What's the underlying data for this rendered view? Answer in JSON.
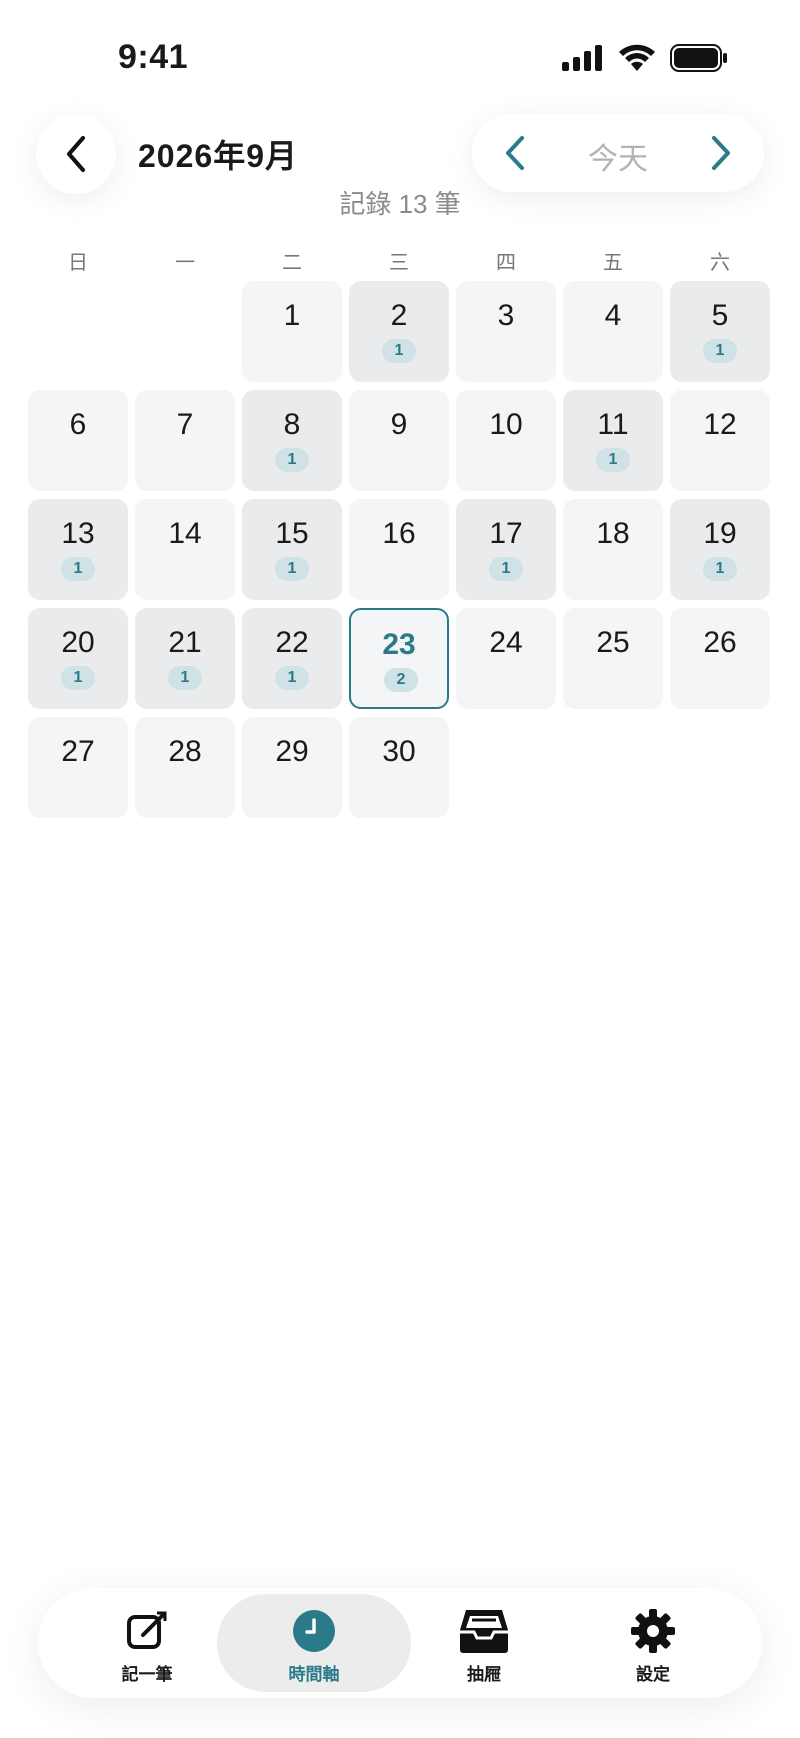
{
  "status_bar": {
    "time": "9:41"
  },
  "header": {
    "title": "2026年9月",
    "today_label": "今天",
    "record_count": "記錄 13 筆"
  },
  "weekdays": [
    "日",
    "一",
    "二",
    "三",
    "四",
    "五",
    "六"
  ],
  "calendar": {
    "first_weekday_index": 2,
    "days_in_month": 30,
    "today": 23,
    "entries": {
      "2": "1",
      "5": "1",
      "8": "1",
      "11": "1",
      "13": "1",
      "15": "1",
      "17": "1",
      "19": "1",
      "20": "1",
      "21": "1",
      "22": "1",
      "23": "2"
    }
  },
  "tabbar": {
    "tabs": [
      {
        "label": "記一筆",
        "icon": "compose-icon",
        "active": false
      },
      {
        "label": "時間軸",
        "icon": "clock-icon",
        "active": true
      },
      {
        "label": "抽屜",
        "icon": "tray-icon",
        "active": false
      },
      {
        "label": "設定",
        "icon": "gear-icon",
        "active": false
      }
    ]
  },
  "colors": {
    "accent": "#2b7a89",
    "badge_bg": "#cfe2e6",
    "cell_bg": "#f4f5f6",
    "cell_with_entry_bg": "#eaebed"
  }
}
